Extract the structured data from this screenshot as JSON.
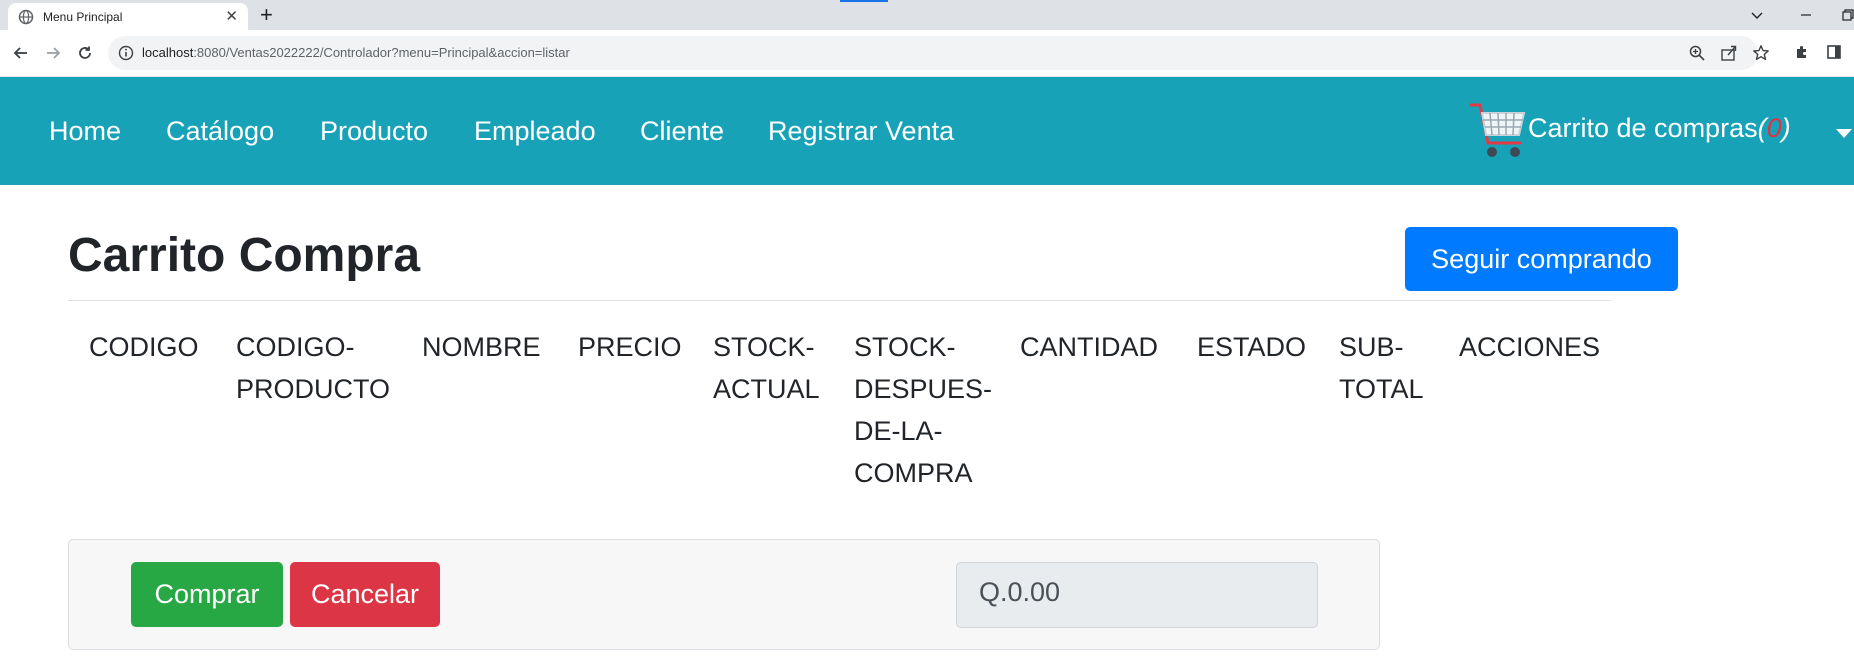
{
  "browser": {
    "tab_title": "Menu Principal",
    "tab_close": "✕",
    "new_tab": "+",
    "url_host": "localhost",
    "url_rest": ":8080/Ventas2022222/Controlador?menu=Principal&accion=listar"
  },
  "navbar": {
    "items": [
      {
        "label": "Home"
      },
      {
        "label": "Catálogo"
      },
      {
        "label": "Producto"
      },
      {
        "label": "Empleado"
      },
      {
        "label": "Cliente"
      },
      {
        "label": "Registrar Venta"
      }
    ],
    "cart_label": "Carrito de compras",
    "cart_open": "(",
    "cart_count": "0",
    "cart_close": ")"
  },
  "page": {
    "title": "Carrito Compra",
    "continue_button": "Seguir comprando"
  },
  "table": {
    "headers": [
      {
        "lines": [
          "CODIGO"
        ]
      },
      {
        "lines": [
          "CODIGO-",
          "PRODUCTO"
        ]
      },
      {
        "lines": [
          "NOMBRE"
        ]
      },
      {
        "lines": [
          "PRECIO"
        ]
      },
      {
        "lines": [
          "STOCK-",
          "ACTUAL"
        ]
      },
      {
        "lines": [
          "STOCK-",
          "DESPUES-",
          "DE-LA-",
          "COMPRA"
        ]
      },
      {
        "lines": [
          "CANTIDAD"
        ]
      },
      {
        "lines": [
          "ESTADO"
        ]
      },
      {
        "lines": [
          "SUB-",
          "TOTAL"
        ]
      },
      {
        "lines": [
          "ACCIONES"
        ]
      }
    ]
  },
  "footer": {
    "buy_button": "Comprar",
    "cancel_button": "Cancelar",
    "total_value": "Q.0.00"
  },
  "colors": {
    "navbar": "#17a2b8",
    "primary": "#007bff",
    "success": "#28a745",
    "danger": "#dc3545"
  }
}
